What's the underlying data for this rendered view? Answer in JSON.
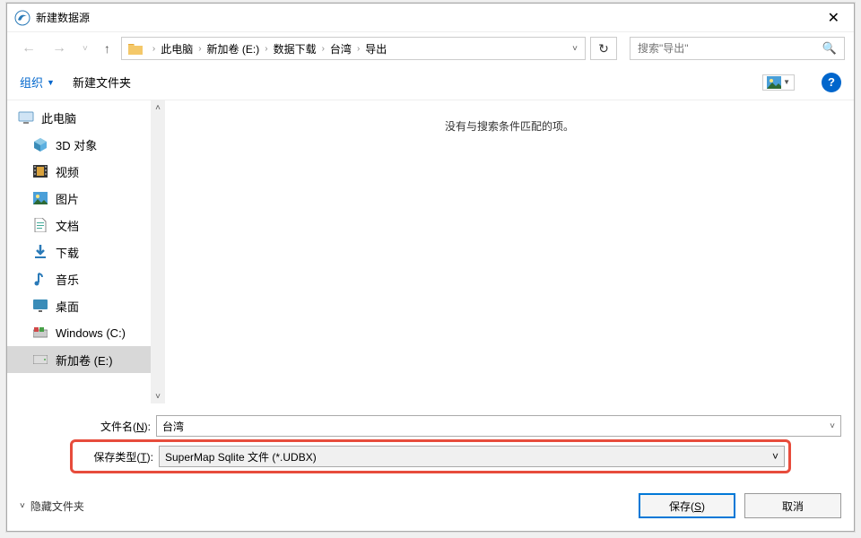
{
  "window": {
    "title": "新建数据源"
  },
  "breadcrumb": {
    "parts": [
      "此电脑",
      "新加卷 (E:)",
      "数据下载",
      "台湾",
      "导出"
    ]
  },
  "search": {
    "placeholder": "搜索\"导出\""
  },
  "toolbar": {
    "organize": "组织",
    "new_folder": "新建文件夹"
  },
  "sidebar": {
    "root": "此电脑",
    "items": [
      {
        "label": "3D 对象",
        "icon": "cube"
      },
      {
        "label": "视频",
        "icon": "film"
      },
      {
        "label": "图片",
        "icon": "pics"
      },
      {
        "label": "文档",
        "icon": "doc"
      },
      {
        "label": "下载",
        "icon": "download"
      },
      {
        "label": "音乐",
        "icon": "music"
      },
      {
        "label": "桌面",
        "icon": "desktop"
      },
      {
        "label": "Windows (C:)",
        "icon": "drive-c"
      },
      {
        "label": "新加卷 (E:)",
        "icon": "drive"
      }
    ]
  },
  "content": {
    "empty": "没有与搜索条件匹配的项。"
  },
  "fields": {
    "filename_label_pre": "文件名(",
    "filename_label_key": "N",
    "filename_label_post": "):",
    "filename_value": "台湾",
    "savetype_label_pre": "保存类型(",
    "savetype_label_key": "T",
    "savetype_label_post": "):",
    "savetype_value": "SuperMap Sqlite 文件 (*.UDBX)"
  },
  "footer": {
    "hide_folders": "隐藏文件夹",
    "save_pre": "保存(",
    "save_key": "S",
    "save_post": ")",
    "cancel": "取消"
  }
}
